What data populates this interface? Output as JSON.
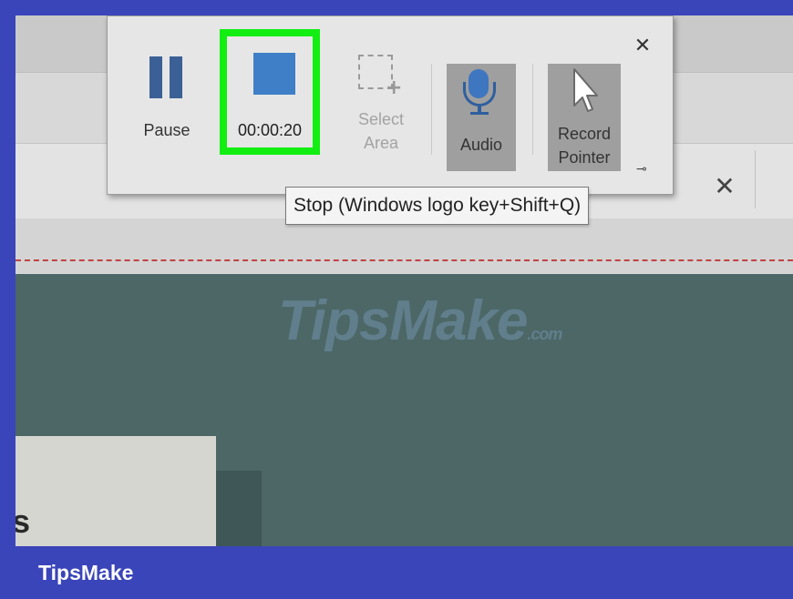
{
  "toolbar": {
    "pause_label": "Pause",
    "stop_timer": "00:00:20",
    "select_area_line1": "Select",
    "select_area_line2": "Area",
    "audio_label": "Audio",
    "record_pointer_line1": "Record",
    "record_pointer_line2": "Pointer",
    "close_glyph": "✕",
    "pin_glyph": "⊸"
  },
  "tooltip": {
    "text": "Stop (Windows logo key+Shift+Q)"
  },
  "window": {
    "close_glyph": "✕"
  },
  "watermark": {
    "text": "TipsMake",
    "suffix": ".com"
  },
  "footer": {
    "brand": "TipsMake"
  },
  "colors": {
    "frame": "#3a45b9",
    "stop_highlight": "#12ee12",
    "icon_blue": "#3e7fc7",
    "teal_area": "#4c6766"
  },
  "icons": [
    "pause-icon",
    "stop-icon",
    "select-area-icon",
    "microphone-icon",
    "cursor-icon",
    "close-icon",
    "pin-icon"
  ]
}
